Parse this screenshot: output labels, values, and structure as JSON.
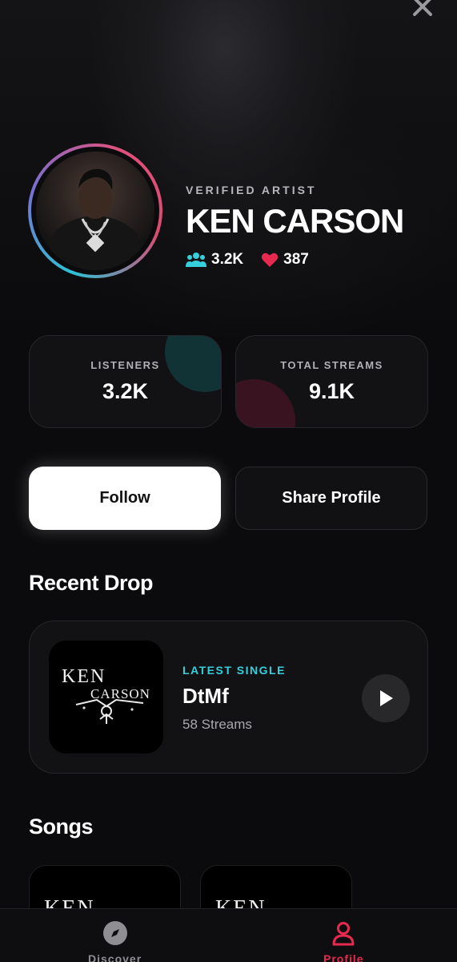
{
  "header": {
    "close_icon": "close-icon"
  },
  "artist": {
    "verified_label": "VERIFIED ARTIST",
    "name": "KEN CARSON",
    "followers": "3.2K",
    "likes": "387",
    "followers_icon": "users-icon",
    "likes_icon": "heart-icon"
  },
  "stats": [
    {
      "label": "LISTENERS",
      "value": "3.2K"
    },
    {
      "label": "TOTAL STREAMS",
      "value": "9.1K"
    }
  ],
  "actions": {
    "follow_label": "Follow",
    "share_label": "Share Profile"
  },
  "recent_drop": {
    "section_title": "Recent Drop",
    "tag": "LATEST SINGLE",
    "title": "DtMf",
    "streams": "58 Streams",
    "cover_text_1": "KEN",
    "cover_text_2": "CARSON"
  },
  "songs": {
    "section_title": "Songs"
  },
  "nav": {
    "items": [
      {
        "label": "Discover",
        "icon": "compass-icon",
        "active": false
      },
      {
        "label": "Profile",
        "icon": "user-icon",
        "active": true
      }
    ]
  },
  "colors": {
    "accent_teal": "#35d0dd",
    "accent_red": "#e8294f",
    "background": "#0b0b0d",
    "card": "#121214"
  }
}
